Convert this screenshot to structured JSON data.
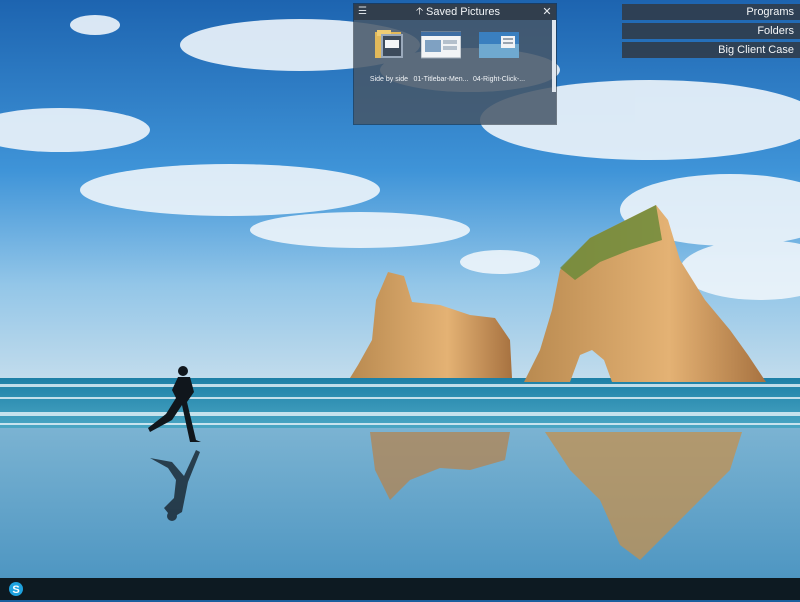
{
  "fence": {
    "title": "Saved Pictures",
    "items": [
      {
        "label": "Side by side",
        "icon": "folder-icon"
      },
      {
        "label": "01-Titlebar-Men...",
        "icon": "screenshot-thumbnail"
      },
      {
        "label": "04-Right-Click-...",
        "icon": "screenshot-thumbnail"
      }
    ]
  },
  "pinned": {
    "programs": "Programs",
    "folders": "Folders",
    "big_client": "Big Client Case"
  },
  "taskbar": {
    "apps": [
      {
        "icon": "skype-icon"
      }
    ]
  },
  "colors": {
    "fence_bg": "#465668",
    "taskbar_bg": "#0d1a22"
  }
}
